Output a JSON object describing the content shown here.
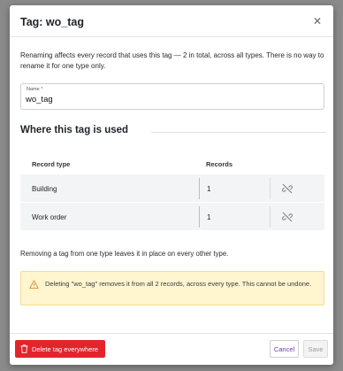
{
  "dialog": {
    "title": "Tag: wo_tag",
    "close_icon": "close-icon",
    "intro": "Renaming affects every record that uses this tag — 2 in total, across all types. There is no way to rename it for one type only."
  },
  "name_field": {
    "label": "Name",
    "required_mark": "*",
    "value": "wo_tag"
  },
  "usage": {
    "title": "Where this tag is used",
    "columns": [
      "Record type",
      "Records"
    ],
    "rows": [
      {
        "type": "Building",
        "records": "1",
        "action_icon": "unlink-icon"
      },
      {
        "type": "Work order",
        "records": "1",
        "action_icon": "unlink-icon"
      }
    ]
  },
  "note": "Removing a tag from one type leaves it in place on every other type.",
  "warning": {
    "icon": "warning-icon",
    "text": "Deleting \"wo_tag\" removes it from all 2 records, across every type. This cannot be undone."
  },
  "footer": {
    "delete_label": "Delete tag everywhere",
    "cancel_label": "Cancel",
    "save_label": "Save"
  },
  "colors": {
    "danger": "#e2252c",
    "warning_bg": "#fff5cf",
    "accent": "#6b3ca8"
  }
}
